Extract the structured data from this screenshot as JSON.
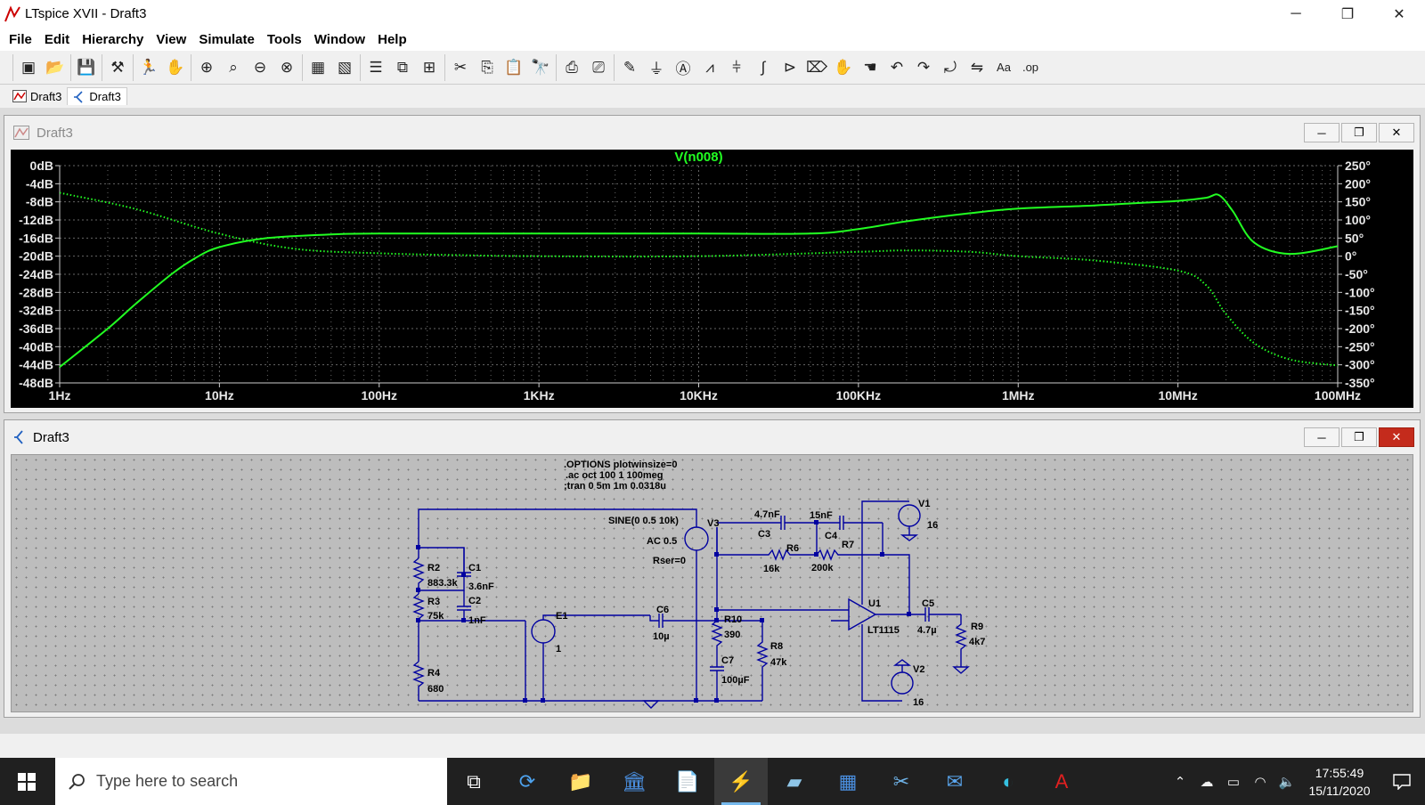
{
  "window": {
    "title": "LTspice XVII - Draft3",
    "minimize": "─",
    "maximize": "❐",
    "close": "✕"
  },
  "menu": [
    "File",
    "Edit",
    "Hierarchy",
    "View",
    "Simulate",
    "Tools",
    "Window",
    "Help"
  ],
  "toolbar_icons": [
    [
      "new-schematic-icon",
      "open-icon"
    ],
    [
      "save-icon"
    ],
    [
      "control-panel-icon"
    ],
    [
      "run-icon",
      "halt-icon"
    ],
    [
      "zoom-in-icon",
      "zoom-area-icon",
      "zoom-out-icon",
      "zoom-full-icon"
    ],
    [
      "tile-icon",
      "cascade-icon"
    ],
    [
      "window-horizontal-icon",
      "window-vertical-icon",
      "window-arrange-icon"
    ],
    [
      "cut-icon",
      "copy-icon",
      "paste-icon",
      "find-icon"
    ],
    [
      "print-icon",
      "print-preview-icon"
    ],
    [
      "wire-icon",
      "ground-icon",
      "label-net-icon",
      "resistor-icon",
      "capacitor-icon",
      "inductor-icon",
      "diode-icon",
      "component-icon",
      "move-icon",
      "drag-icon",
      "undo-icon",
      "redo-icon",
      "rotate-icon",
      "mirror-icon",
      "text-icon",
      "spice-directive-icon"
    ]
  ],
  "doc_tabs": [
    {
      "label": "Draft3",
      "kind": "waveform"
    },
    {
      "label": "Draft3",
      "kind": "schematic"
    }
  ],
  "plot_window": {
    "title": "Draft3",
    "trace_label": "V(n008)",
    "trace_color": "#22ff22"
  },
  "schematic_window": {
    "title": "Draft3"
  },
  "chart_data": {
    "type": "line",
    "title": "V(n008)",
    "x_scale": "log",
    "x_ticks": [
      "1Hz",
      "10Hz",
      "100Hz",
      "1KHz",
      "10KHz",
      "100KHz",
      "1MHz",
      "10MHz",
      "100MHz"
    ],
    "y_left_ticks": [
      "0dB",
      "-4dB",
      "-8dB",
      "-12dB",
      "-16dB",
      "-20dB",
      "-24dB",
      "-28dB",
      "-32dB",
      "-36dB",
      "-40dB",
      "-44dB",
      "-48dB"
    ],
    "y_right_ticks": [
      "250°",
      "200°",
      "150°",
      "100°",
      "50°",
      "0°",
      "-50°",
      "-100°",
      "-150°",
      "-200°",
      "-250°",
      "-300°",
      "-350°"
    ],
    "ylim_left": [
      -48,
      0
    ],
    "ylim_right": [
      -350,
      250
    ],
    "grid": true,
    "series": [
      {
        "name": "magnitude",
        "style": "solid",
        "axis": "left",
        "x": [
          1,
          2,
          3,
          5,
          7,
          10,
          20,
          50,
          100,
          1000,
          10000,
          50000,
          100000,
          200000,
          500000,
          1000000,
          3000000,
          6000000,
          10000000,
          15000000,
          18000000,
          22000000,
          30000000,
          50000000,
          100000000
        ],
        "y": [
          -44.5,
          -36,
          -30.5,
          -24,
          -20.5,
          -18,
          -16,
          -15.2,
          -15,
          -15,
          -15,
          -15,
          -14,
          -12.3,
          -10.5,
          -9.5,
          -8.8,
          -8.2,
          -7.8,
          -7.1,
          -6.5,
          -10,
          -17,
          -19.5,
          -17.8
        ]
      },
      {
        "name": "phase",
        "style": "dotted",
        "axis": "right",
        "x": [
          1,
          3,
          10,
          30,
          100,
          300,
          1000,
          10000,
          100000,
          200000,
          500000,
          1000000,
          3000000,
          10000000,
          15000000,
          20000000,
          30000000,
          50000000,
          100000000
        ],
        "y": [
          175,
          130,
          62,
          20,
          8,
          3,
          0,
          0,
          12,
          16,
          12,
          0,
          -12,
          -40,
          -80,
          -160,
          -240,
          -285,
          -302
        ]
      }
    ]
  },
  "schematic": {
    "directives": [
      ".OPTIONS plotwinsize=0",
      ".ac oct 100 1 100meg",
      ";tran 0 5m 1m 0.0318u"
    ],
    "labels": {
      "R2": "R2",
      "R2v": "883.3k",
      "R3": "R3",
      "R3v": "75k",
      "R4": "R4",
      "R4v": "680",
      "C1": "C1",
      "C1v": "3.6nF",
      "C2": "C2",
      "C2v": "1nF",
      "E1": "E1",
      "E1v": "1",
      "C6": "C6",
      "C6v": "10µ",
      "V3": "V3",
      "V3src": "SINE(0 0.5 10k)",
      "V3ac": "AC 0.5",
      "V3r": "Rser=0",
      "R10": "R10",
      "R10v": "390",
      "C7": "C7",
      "C7v": "100µF",
      "R8": "R8",
      "R8v": "47k",
      "C3": "C3",
      "C3v": "4.7nF",
      "C4": "C4",
      "C4v": "15nF",
      "R6": "R6",
      "R6v": "16k",
      "R7": "R7",
      "R7v": "200k",
      "U1": "U1",
      "U1v": "LT1115",
      "V1": "V1",
      "V1v": "16",
      "V2": "V2",
      "V2v": "16",
      "C5": "C5",
      "C5v": "4.7µ",
      "R9": "R9",
      "R9v": "4k7"
    }
  },
  "taskbar": {
    "search_placeholder": "Type here to search",
    "apps": [
      "task-view-icon",
      "sync-icon",
      "file-explorer-icon",
      "library-icon",
      "document-icon",
      "ltspice-icon",
      "notes-icon",
      "calculator-icon",
      "snip-icon",
      "mail-icon",
      "edge-icon",
      "acrobat-icon"
    ],
    "active_app": "ltspice-icon",
    "time": "17:55:49",
    "date": "15/11/2020"
  }
}
